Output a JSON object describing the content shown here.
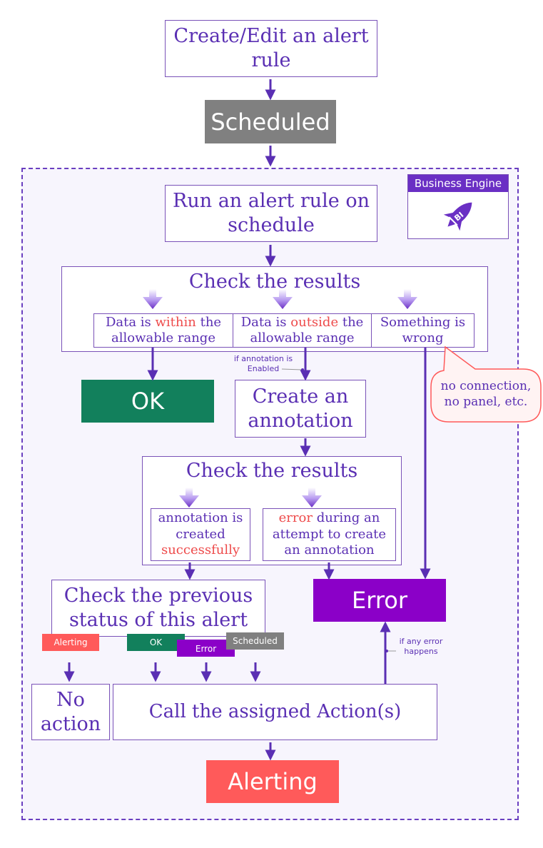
{
  "nodes": {
    "create_edit": "Create/Edit an alert rule",
    "scheduled": "Scheduled",
    "run_rule": "Run an alert rule on schedule",
    "check_results_1": "Check the results",
    "within_pre": "Data is ",
    "within_word": "within",
    "within_post": " the allowable range",
    "outside_pre": "Data is ",
    "outside_word": "outside",
    "outside_post": " the allowable range",
    "wrong": "Something is wrong",
    "ok": "OK",
    "create_annotation": "Create an annotation",
    "check_results_2": "Check the results",
    "ann_created_pre": "annotation is created ",
    "ann_created_word": "successfully",
    "ann_error_word": "error",
    "ann_error_post": " during an attempt to create an annotation",
    "check_prev": "Check the previous status of this alert",
    "error": "Error",
    "no_action": "No action",
    "call_actions": "Call the assigned Action(s)",
    "alerting": "Alerting"
  },
  "callout": "no connection, no panel, etc.",
  "notes": {
    "if_annotation": "if annotation is Enabled",
    "if_any_error": "if any error happens"
  },
  "status_tags": {
    "alerting": "Alerting",
    "ok": "OK",
    "error": "Error",
    "scheduled": "Scheduled"
  },
  "logo": {
    "label": "Business Engine",
    "badge": "BI"
  },
  "colors": {
    "purple": "#5a2fb3",
    "gray": "#808080",
    "green": "#12805c",
    "violet": "#8b00c8",
    "red": "#ff5a5a",
    "highlight": "#ee4b4b"
  }
}
